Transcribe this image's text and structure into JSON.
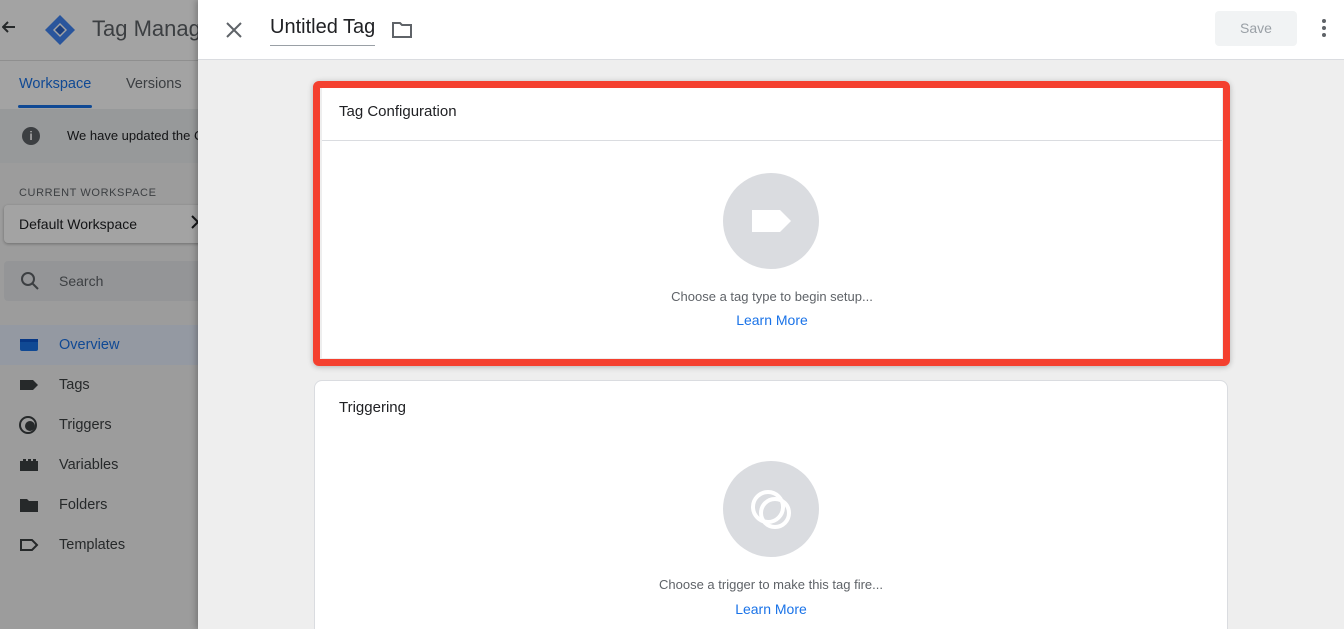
{
  "background": {
    "app_title": "Tag Manager",
    "tabs": [
      {
        "label": "Workspace",
        "active": true
      },
      {
        "label": "Versions",
        "active": false
      }
    ],
    "notice_text": "We have updated the C",
    "current_workspace_label": "CURRENT WORKSPACE",
    "workspace_name": "Default Workspace",
    "search_placeholder": "Search",
    "nav": [
      {
        "label": "Overview",
        "icon": "overview-icon",
        "active": true
      },
      {
        "label": "Tags",
        "icon": "tag-icon",
        "active": false
      },
      {
        "label": "Triggers",
        "icon": "trigger-icon",
        "active": false
      },
      {
        "label": "Variables",
        "icon": "variables-icon",
        "active": false
      },
      {
        "label": "Folders",
        "icon": "folder-icon",
        "active": false
      },
      {
        "label": "Templates",
        "icon": "template-icon",
        "active": false
      }
    ]
  },
  "editor": {
    "tag_name": "Untitled Tag",
    "save_label": "Save",
    "tag_configuration": {
      "title": "Tag Configuration",
      "placeholder": "Choose a tag type to begin setup...",
      "learn_more": "Learn More"
    },
    "triggering": {
      "title": "Triggering",
      "placeholder": "Choose a trigger to make this tag fire...",
      "learn_more": "Learn More"
    }
  },
  "colors": {
    "accent": "#1a73e8",
    "highlight": "#f4402f"
  }
}
